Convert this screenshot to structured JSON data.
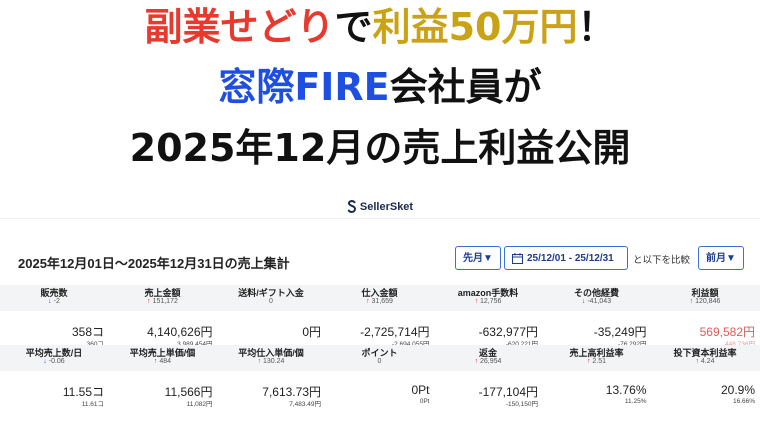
{
  "headline": {
    "line1": {
      "red": "副業せどり",
      "black1": "で",
      "gold": "利益50万円",
      "black2": "！"
    },
    "line2": {
      "blue": "窓際FIRE",
      "black": "会社員が"
    },
    "line3": "2025年12月の売上利益公開"
  },
  "brand": {
    "name": "SellerSket",
    "logo_icon": "sellersket-logo-icon"
  },
  "report": {
    "title": "2025年12月01日〜2025年12月31日の売上集計",
    "period_button": "月▼",
    "period_prefix": "先",
    "date_range": "25/12/01 - 25/12/31",
    "compare_text": "と以下を比較",
    "prev_button": "前月▼"
  },
  "colors": {
    "red": "#e8392f",
    "gold": "#c9a215",
    "blue": "#1e4fe0",
    "accent": "#3b6fd1",
    "up": "#dd2233",
    "down": "#2b5ad6"
  },
  "metrics_row1": [
    {
      "label": "販売数",
      "dir": "down",
      "delta": "-2",
      "value": "358コ",
      "prev": "360コ"
    },
    {
      "label": "売上金額",
      "dir": "up",
      "delta": "151,172",
      "value": "4,140,626円",
      "prev": "3,989,454円"
    },
    {
      "label": "送料/ギフト入金",
      "dir": "",
      "delta": "0",
      "value": "0円",
      "prev": ""
    },
    {
      "label": "仕入金額",
      "dir": "up",
      "delta": "31,659",
      "value": "-2,725,714円",
      "prev": "-2,694,055円"
    },
    {
      "label": "amazon手数料",
      "dir": "up",
      "delta": "12,756",
      "value": "-632,977円",
      "prev": "-620,221円"
    },
    {
      "label": "その他経費",
      "dir": "down",
      "delta": "-41,043",
      "value": "-35,249円",
      "prev": "-76,292円"
    },
    {
      "label": "利益額",
      "dir": "up",
      "delta": "120,846",
      "value": "569,582円",
      "prev": "448,736円"
    }
  ],
  "metrics_row2": [
    {
      "label": "平均売上数/日",
      "dir": "down",
      "delta": "-0.06",
      "value": "11.55コ",
      "prev": "11.61コ"
    },
    {
      "label": "平均売上単価/個",
      "dir": "up",
      "delta": "484",
      "value": "11,566円",
      "prev": "11,082円"
    },
    {
      "label": "平均仕入単価/個",
      "dir": "up",
      "delta": "130.24",
      "value": "7,613.73円",
      "prev": "7,483.49円"
    },
    {
      "label": "ポイント",
      "dir": "",
      "delta": "0",
      "value": "0Pt",
      "prev": "0Pt"
    },
    {
      "label": "返金",
      "dir": "up",
      "delta": "26,954",
      "value": "-177,104円",
      "prev": "-150,150円"
    },
    {
      "label": "売上高利益率",
      "dir": "up",
      "delta": "2.51",
      "value": "13.76%",
      "prev": "11.25%"
    },
    {
      "label": "投下資本利益率",
      "dir": "up",
      "delta": "4.24",
      "value": "20.9%",
      "prev": "16.66%"
    }
  ]
}
